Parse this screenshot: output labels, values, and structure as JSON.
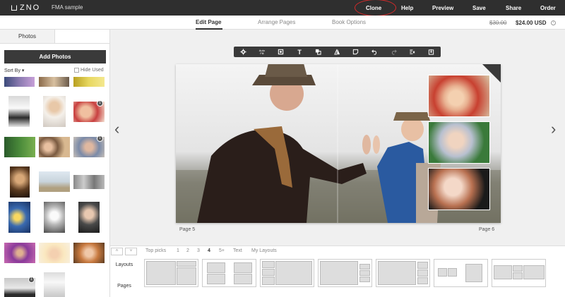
{
  "app": {
    "logo_text": "ZNO",
    "project_name": "FMA sample"
  },
  "topnav": {
    "clone": "Clone",
    "help": "Help",
    "preview": "Preview",
    "save": "Save",
    "share": "Share",
    "order": "Order"
  },
  "subnav": {
    "tabs": [
      "Edit Page",
      "Arrange Pages",
      "Book Options"
    ],
    "price_old": "$30.00",
    "price_new": "$24.00 USD",
    "info": "i"
  },
  "left_panel": {
    "tab": "Photos",
    "add_photos": "Add Photos",
    "sort_by": "Sort By ▾",
    "hide_used": "Hide Used",
    "badges": [
      "1",
      "1",
      "1"
    ]
  },
  "toolbar": {
    "auto_fill": "Auto Fill",
    "text_tool": "T"
  },
  "canvas": {
    "left_page": "Page 5",
    "right_page": "Page 6",
    "prev_arrow": "‹",
    "next_arrow": "›"
  },
  "layouts": {
    "up": "˄",
    "down": "˅",
    "filters": [
      "Top picks",
      "1",
      "2",
      "3",
      "4",
      "5+",
      "Text",
      "My Layouts"
    ],
    "side_tabs": [
      "Layouts",
      "Pages"
    ]
  }
}
